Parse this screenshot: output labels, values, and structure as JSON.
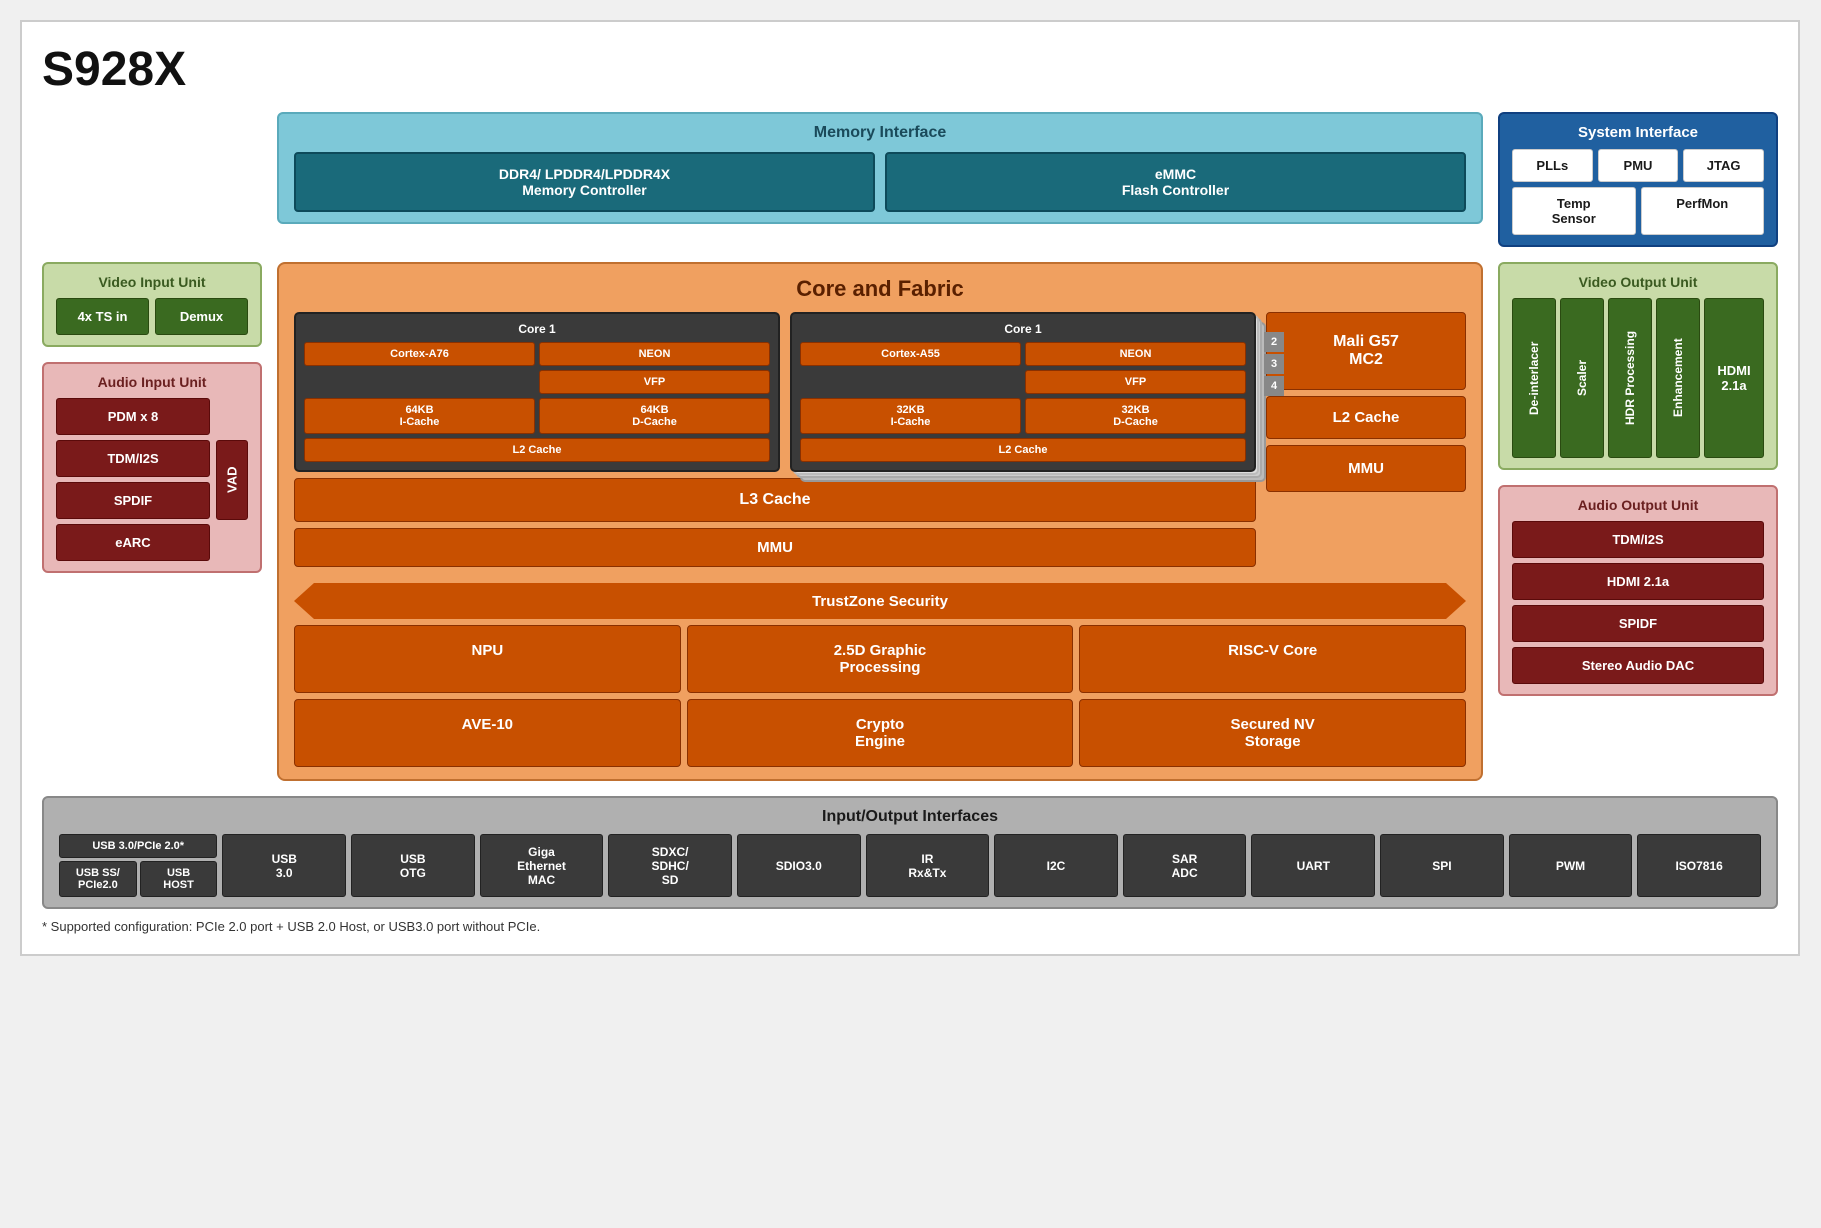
{
  "title": "S928X",
  "memory_interface": {
    "title": "Memory Interface",
    "ddr_label": "DDR4/ LPDDR4/LPDDR4X\nMemory Controller",
    "emmc_label": "eMMC\nFlash Controller"
  },
  "system_interface": {
    "title": "System Interface",
    "items": [
      "PLLs",
      "PMU",
      "JTAG",
      "Temp\nSensor",
      "PerfMon"
    ]
  },
  "video_input": {
    "title": "Video Input Unit",
    "ts_in": "4x TS in",
    "demux": "Demux"
  },
  "audio_input": {
    "title": "Audio Input Unit",
    "pdm": "PDM x 8",
    "tdm": "TDM/I2S",
    "spdif": "SPDIF",
    "earc": "eARC",
    "vad": "VAD"
  },
  "core_fabric": {
    "title": "Core and Fabric",
    "core1_a76_label": "Core 1",
    "cortex_a76": "Cortex-A76",
    "neon_a76": "NEON",
    "vfp_a76": "VFP",
    "icache_64": "64KB\nI-Cache",
    "dcache_64": "64KB\nD-Cache",
    "l2_a76": "L2 Cache",
    "core1_a55_label": "Core 1",
    "cortex_a55": "Cortex-A55",
    "neon_a55": "NEON",
    "vfp_a55": "VFP",
    "icache_32": "32KB\nI-Cache",
    "dcache_32": "32KB\nD-Cache",
    "l2_a55": "L2 Cache",
    "badges": [
      "2",
      "3",
      "4"
    ],
    "mali": "Mali G57\nMC2",
    "l2_cache": "L2 Cache",
    "mmu_gpu": "MMU",
    "l3_cache": "L3 Cache",
    "mmu_main": "MMU",
    "trustzone": "TrustZone Security",
    "npu": "NPU",
    "graphic": "2.5D Graphic\nProcessing",
    "risc_v": "RISC-V Core",
    "ave10": "AVE-10",
    "crypto": "Crypto\nEngine",
    "secured_nv": "Secured NV\nStorage"
  },
  "video_output": {
    "title": "Video Output Unit",
    "de_interlacer": "De-interlacer",
    "scaler": "Scaler",
    "hdr": "HDR Processing",
    "enhancement": "Enhancement",
    "hdmi": "HDMI 2.1a"
  },
  "audio_output": {
    "title": "Audio Output Unit",
    "tdm": "TDM/I2S",
    "hdmi": "HDMI 2.1a",
    "spidf": "SPIDF",
    "stereo": "Stereo Audio DAC"
  },
  "io": {
    "title": "Input/Output Interfaces",
    "usb_pcie_top": "USB  3.0/PCIe 2.0*",
    "usb_ss": "USB SS/\nPCIe2.0",
    "usb_host": "USB\nHOST",
    "usb30": "USB\n3.0",
    "usb_otg": "USB\nOTG",
    "giga_eth": "Giga\nEthernet\nMAC",
    "sdxc": "SDXC/\nSDHC/\nSD",
    "sdio30": "SDIO3.0",
    "ir": "IR\nRx&Tx",
    "i2c": "I2C",
    "sar_adc": "SAR\nADC",
    "uart": "UART",
    "spi": "SPI",
    "pwm": "PWM",
    "iso7816": "ISO7816"
  },
  "footnote": "* Supported configuration: PCIe 2.0 port + USB 2.0 Host, or USB3.0 port without PCIe."
}
